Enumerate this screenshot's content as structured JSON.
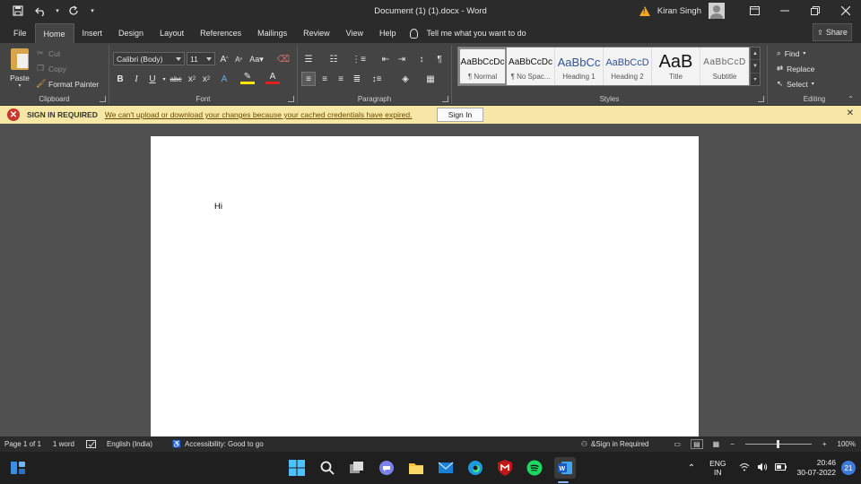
{
  "titlebar": {
    "title": "Document (1) (1).docx  -  Word",
    "user_name": "Kiran Singh",
    "more_glyph": "▾"
  },
  "tabs": [
    {
      "label": "File"
    },
    {
      "label": "Home"
    },
    {
      "label": "Insert"
    },
    {
      "label": "Design"
    },
    {
      "label": "Layout"
    },
    {
      "label": "References"
    },
    {
      "label": "Mailings"
    },
    {
      "label": "Review"
    },
    {
      "label": "View"
    },
    {
      "label": "Help"
    }
  ],
  "tell_me": "Tell me what you want to do",
  "share": "Share",
  "clipboard": {
    "paste": "Paste",
    "cut": "Cut",
    "copy": "Copy",
    "format_painter": "Format Painter",
    "label": "Clipboard"
  },
  "font": {
    "name": "Calibri (Body)",
    "size": "11",
    "label": "Font"
  },
  "paragraph": {
    "label": "Paragraph"
  },
  "styles": {
    "label": "Styles",
    "items": [
      {
        "sample": "AaBbCcDc",
        "name": "¶ Normal"
      },
      {
        "sample": "AaBbCcDc",
        "name": "¶ No Spac..."
      },
      {
        "sample": "AaBbCc",
        "name": "Heading 1"
      },
      {
        "sample": "AaBbCcD",
        "name": "Heading 2"
      },
      {
        "sample": "AaB",
        "name": "Title"
      },
      {
        "sample": "AaBbCcD",
        "name": "Subtitle"
      }
    ]
  },
  "editing": {
    "find": "Find",
    "replace": "Replace",
    "select": "Select",
    "label": "Editing"
  },
  "notification": {
    "title": "SIGN IN REQUIRED",
    "message": "We can't upload or download your changes because your cached credentials have expired.",
    "button": "Sign In"
  },
  "document": {
    "text": "Hi"
  },
  "statusbar": {
    "page": "Page 1 of 1",
    "words": "1 word",
    "language": "English (India)",
    "accessibility": "Accessibility: Good to go",
    "signin": "&Sign in Required",
    "zoom": "100%",
    "zoom_fraction": 0.5
  },
  "taskbar": {
    "lang_top": "ENG",
    "lang_bottom": "IN",
    "time": "20:46",
    "date": "30-07-2022",
    "notifications": "21"
  },
  "colors": {
    "notification_bg": "#f7e7a6",
    "error_red": "#c8352b",
    "ribbon_bg": "#444444",
    "title_bg": "#2b2b2b"
  }
}
